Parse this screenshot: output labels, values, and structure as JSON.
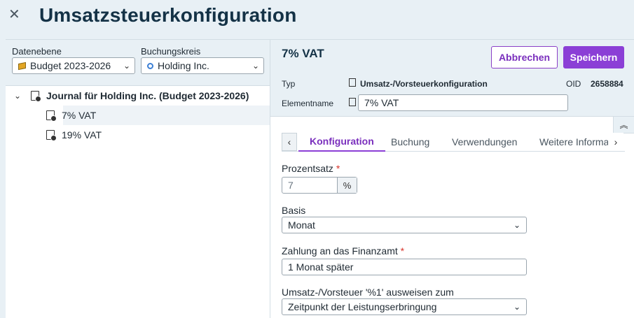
{
  "header": {
    "title": "Umsatzsteuerkonfiguration",
    "close_icon": "close-icon"
  },
  "filters": {
    "datenebene_label": "Datenebene",
    "datenebene_value": "Budget 2023-2026",
    "buchungskreis_label": "Buchungskreis",
    "buchungskreis_value": "Holding Inc."
  },
  "tree": {
    "root_label": "Journal für Holding Inc. (Budget 2023-2026)",
    "children": [
      {
        "label": "7% VAT",
        "selected": true
      },
      {
        "label": "19% VAT",
        "selected": false
      }
    ]
  },
  "detail": {
    "title": "7% VAT",
    "cancel_label": "Abbrechen",
    "save_label": "Speichern",
    "typ_label": "Typ",
    "typ_value": "Umsatz-/Vorsteuerkonfiguration",
    "oid_label": "OID",
    "oid_value": "2658884",
    "elementname_label": "Elementname",
    "elementname_value": "7% VAT"
  },
  "tabs": [
    "Konfiguration",
    "Buchung",
    "Verwendungen",
    "Weitere Informa"
  ],
  "form": {
    "prozentsatz_label": "Prozentsatz",
    "prozentsatz_value": "7",
    "prozentsatz_unit": "%",
    "basis_label": "Basis",
    "basis_value": "Monat",
    "zahlung_label": "Zahlung an das Finanzamt",
    "zahlung_value": "1 Monat später",
    "ausweisen_label": "Umsatz-/Vorsteuer '%1' ausweisen zum",
    "ausweisen_value": "Zeitpunkt der Leistungserbringung",
    "required_mark": "*"
  },
  "colors": {
    "accent": "#8b3fd6",
    "title": "#143246",
    "background": "#e8f0f5"
  }
}
